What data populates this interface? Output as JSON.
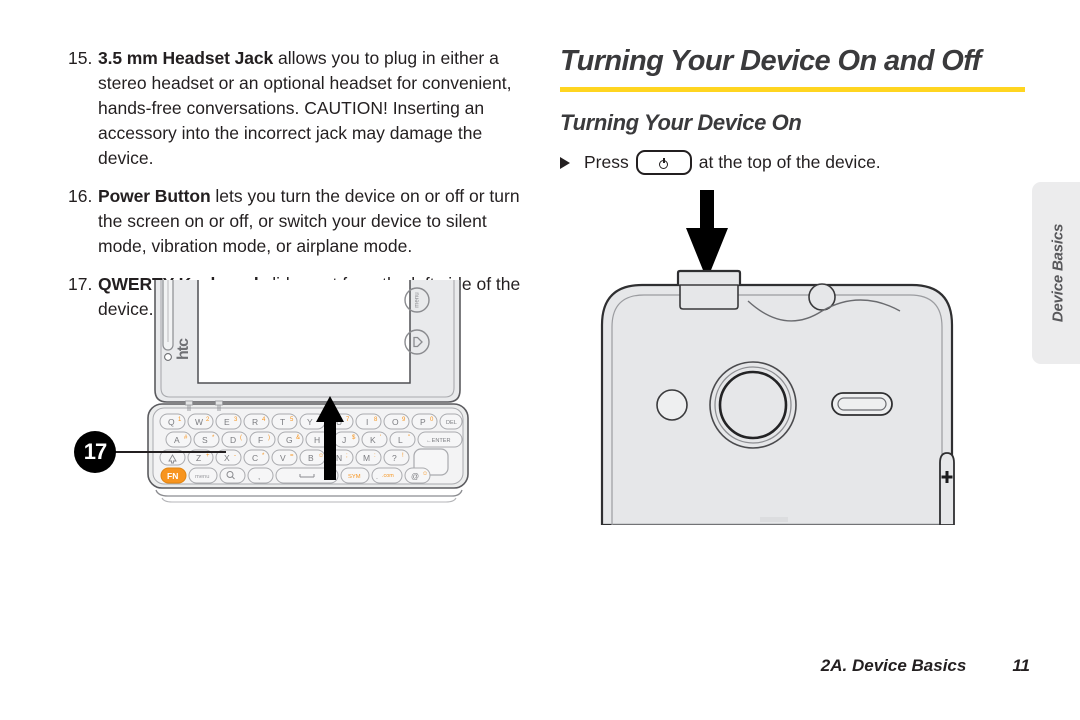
{
  "page": {
    "background": "#ffffff",
    "accent_rule_color": "#ffd520"
  },
  "left_column": {
    "items": [
      {
        "number": "15.",
        "term": "3.5 mm Headset Jack",
        "text": " allows you to plug in either a stereo headset or an optional headset for convenient, hands-free conversations. CAUTION! Inserting an accessory into the incorrect jack may damage the device."
      },
      {
        "number": "16.",
        "term": "Power Button",
        "text": " lets you turn the device on or off or turn the screen on or off, or switch your device to silent mode, vibration mode, or airplane mode."
      },
      {
        "number": "17.",
        "term": "QWERTY Keyboard",
        "text": " slides out from the left side of the device."
      }
    ],
    "callout_number": "17",
    "illustration": {
      "name": "htc-device-qwerty-keyboard-slide-out",
      "brand_logo": "htc",
      "button_labels": [
        "menu",
        "back"
      ],
      "keyboard_rows": [
        [
          "Q",
          "W",
          "E",
          "R",
          "T",
          "Y",
          "U",
          "I",
          "O",
          "P",
          "DEL"
        ],
        [
          "A",
          "S",
          "D",
          "F",
          "G",
          "H",
          "J",
          "K",
          "L",
          "ENTER"
        ],
        [
          "shift",
          "Z",
          "X",
          "C",
          "V",
          "B",
          "N",
          "M",
          "?"
        ],
        [
          "FN",
          "menu",
          "search",
          ",",
          "space",
          "SYM",
          ".com",
          "@"
        ]
      ],
      "key_alt_symbols": [
        "1",
        "2",
        "3",
        "4",
        "5",
        "6",
        "7",
        "8",
        "9",
        "0"
      ],
      "fn_key_color": "#f7941e"
    }
  },
  "right_column": {
    "heading": "Turning Your Device On and Off",
    "subheading": "Turning Your Device On",
    "instruction_prefix": "Press",
    "instruction_suffix": "at the top of the device.",
    "power_key_icon": "power-symbol-icon",
    "illustration": {
      "name": "device-back-power-button-location",
      "parts": [
        "power-button",
        "headset-jack",
        "camera-lens",
        "flash",
        "speaker",
        "volume-rocker"
      ],
      "arrow": "down-arrow-pointing-to-power-button"
    }
  },
  "side_tab": {
    "label": "Device Basics"
  },
  "footer": {
    "section": "2A. Device Basics",
    "page_number": "11"
  }
}
